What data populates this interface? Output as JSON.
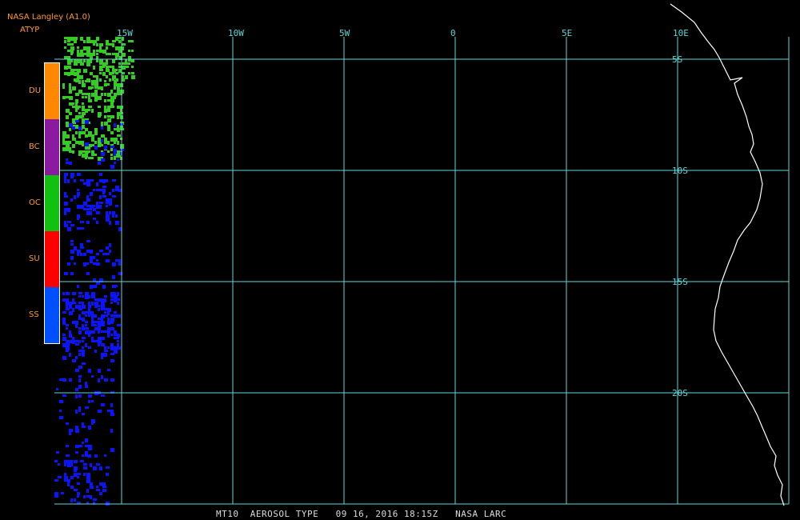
{
  "header": {
    "source": "NASA Langley (A1.0)",
    "product": "ATYP"
  },
  "footer": {
    "caption": "MT10  AEROSOL TYPE   09 16, 2016 18:15Z   NASA LARC"
  },
  "legend": [
    {
      "label": "DU",
      "color": "#ff8800"
    },
    {
      "label": "BC",
      "color": "#8a1aa0"
    },
    {
      "label": "OC",
      "color": "#11c111"
    },
    {
      "label": "SU",
      "color": "#ff0000"
    },
    {
      "label": "SS",
      "color": "#0050ff"
    }
  ],
  "grid": {
    "color": "#5fd7d7",
    "longitudes": [
      "15W",
      "10W",
      "5W",
      "0",
      "5E",
      "10E"
    ],
    "latitudes": [
      "5S",
      "10S",
      "15S",
      "20S"
    ]
  },
  "map_colors": {
    "coastline": "#ffffff",
    "dust_pixels": "#33cc22",
    "salt_pixels": "#0a14ff"
  }
}
